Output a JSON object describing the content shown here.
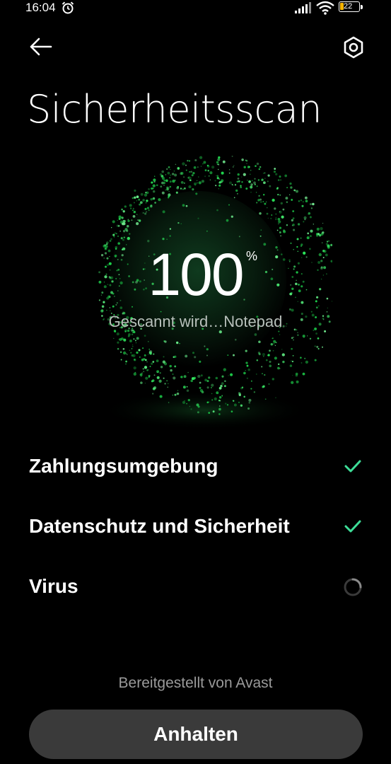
{
  "status_bar": {
    "time": "16:04",
    "battery_level": "22",
    "icons": [
      "alarm-icon",
      "signal-icon",
      "wifi-icon",
      "battery-icon"
    ]
  },
  "header": {
    "back_icon": "arrow-left-icon",
    "settings_icon": "settings-icon",
    "title": "Sicherheitsscan"
  },
  "scan": {
    "progress": "100",
    "percent_sign": "%",
    "status_text": "Gescannt wird…Notepad"
  },
  "checklist": {
    "items": [
      {
        "label": "Zahlungsumgebung",
        "state": "done",
        "icon": "check-icon"
      },
      {
        "label": "Datenschutz und Sicherheit",
        "state": "done",
        "icon": "check-icon"
      },
      {
        "label": "Virus",
        "state": "in-progress",
        "icon": "spinner-icon"
      }
    ]
  },
  "footer": {
    "provider": "Bereitgestellt von Avast",
    "pause_label": "Anhalten"
  },
  "colors": {
    "background": "#000000",
    "accent_green": "#2fd05a",
    "check_color": "#3ddc97",
    "button_bg": "#3a3a3a",
    "battery": "#f5b400"
  }
}
